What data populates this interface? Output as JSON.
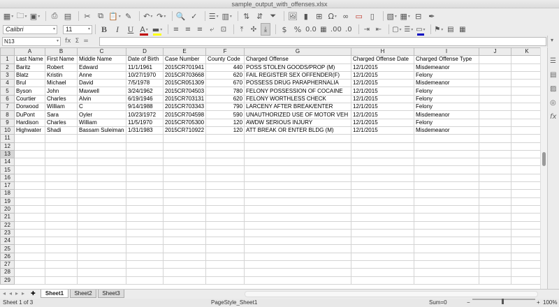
{
  "window": {
    "title": "sample_output_with_offenses.xlsx"
  },
  "toolbar": {
    "icons": [
      "spreadsheet-icon",
      "open-icon",
      "save-icon",
      "print-icon",
      "print-preview-icon",
      "cut-icon",
      "copy-icon",
      "paste-icon",
      "clone-formatting-icon",
      "undo-icon",
      "redo-icon",
      "find-icon",
      "spelling-icon",
      "row-icon",
      "column-icon",
      "sort-ascending-icon",
      "sort-descending-icon",
      "autofilter-icon",
      "image-icon",
      "chart-icon",
      "pivot-table-icon",
      "special-character-icon",
      "hyperlink-icon",
      "comment-icon",
      "headers-footers-icon",
      "define-print-area-icon",
      "freeze-icon",
      "split-window-icon",
      "show-draw-functions-icon"
    ]
  },
  "format_toolbar": {
    "font_name": "Calibri",
    "font_size": "11",
    "bold": "B",
    "italic": "I",
    "underline": "U",
    "currency": "$",
    "percent": "%",
    "number_format": "0.0",
    "font_color": "#c00000",
    "highlight_color": "#ffff00",
    "border_color": "#0000c0"
  },
  "formula_bar": {
    "cell_ref": "N13",
    "fx": "fx",
    "sum": "Σ",
    "equals": "=",
    "value": ""
  },
  "grid": {
    "columns": [
      "A",
      "B",
      "C",
      "D",
      "E",
      "F",
      "G",
      "H",
      "I",
      "J",
      "K"
    ],
    "selected_row": 13,
    "row_count": 29,
    "rows": [
      [
        "Last Name",
        "First Name",
        "Middle Name",
        "Date of Birth",
        "Case Number",
        "County Code",
        "Charged Offense",
        "Charged Offense Date",
        "Charged Offense Type",
        "",
        ""
      ],
      [
        "Baritz",
        "Robert",
        "Edward",
        "11/1/1961",
        "2015CR701941",
        "440",
        "POSS STOLEN GOODS/PROP (M)",
        "12/1/2015",
        "Misdemeanor",
        "",
        ""
      ],
      [
        "Blatz",
        "Kristin",
        "Anne",
        "10/27/1970",
        "2015CR703668",
        "620",
        "FAIL REGISTER SEX OFFENDER(F)",
        "12/1/2015",
        "Felony",
        "",
        ""
      ],
      [
        "Brul",
        "Michael",
        "David",
        "7/5/1978",
        "2015CR051309",
        "670",
        "POSSESS DRUG PARAPHERNALIA",
        "12/1/2015",
        "Misdemeanor",
        "",
        ""
      ],
      [
        "Byson",
        "John",
        "Maxwell",
        "3/24/1962",
        "2015CR704503",
        "780",
        "FELONY POSSESSION OF COCAINE",
        "12/1/2015",
        "Felony",
        "",
        ""
      ],
      [
        "Courtier",
        "Charles",
        "Alvin",
        "6/19/1946",
        "2015CR703131",
        "620",
        "FELONY WORTHLESS CHECK",
        "12/1/2015",
        "Felony",
        "",
        ""
      ],
      [
        "Dorwood",
        "William",
        "C",
        "9/14/1988",
        "2015CR703343",
        "790",
        "LARCENY AFTER BREAK/ENTER",
        "12/1/2015",
        "Felony",
        "",
        ""
      ],
      [
        "DuPont",
        "Sara",
        "Oyler",
        "10/23/1972",
        "2015CR704598",
        "590",
        "UNAUTHORIZED USE OF MOTOR VEH",
        "12/1/2015",
        "Misdemeanor",
        "",
        ""
      ],
      [
        "Hardison",
        "Charles",
        "William",
        "11/5/1970",
        "2015CR705300",
        "120",
        "AWDW SERIOUS INJURY",
        "12/1/2015",
        "Felony",
        "",
        ""
      ],
      [
        "Highwater",
        "Shadi",
        "Bassam Suleiman",
        "1/31/1983",
        "2015CR710922",
        "120",
        "ATT BREAK OR ENTER BLDG (M)",
        "12/1/2015",
        "Misdemeanor",
        "",
        ""
      ]
    ]
  },
  "sheet_tabs": [
    "Sheet1",
    "Sheet2",
    "Sheet3"
  ],
  "active_tab": "Sheet1",
  "statusbar": {
    "sheet_position": "Sheet 1 of 3",
    "page_style": "PageStyle_Sheet1",
    "sum": "Sum=0",
    "zoom_minus": "−",
    "zoom_plus": "+",
    "zoom": "100%"
  },
  "sidebar": {
    "icons": [
      "properties-icon",
      "styles-icon",
      "gallery-icon",
      "navigator-icon",
      "functions-icon"
    ]
  }
}
